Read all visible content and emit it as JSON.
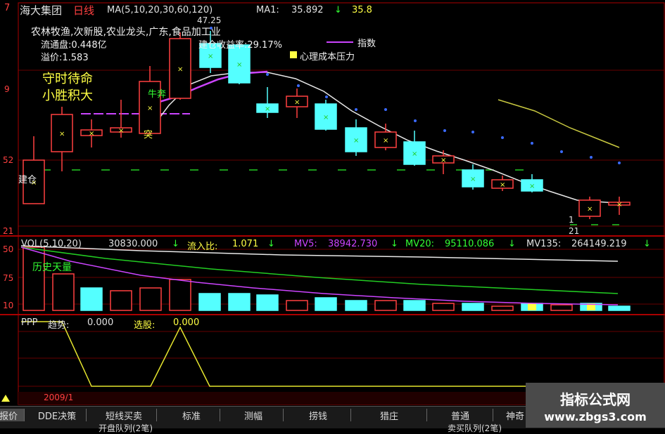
{
  "header": {
    "stock_name": "海大集团",
    "period": "日线",
    "ma_label": "MA(5,10,20,30,60,120)",
    "ma1_label": "MA1:",
    "ma1_value": "35.892",
    "ma1_arrow": "↓",
    "ma_extra": "35.8",
    "left_price_top": "7"
  },
  "info": {
    "industry": "农林牧渔,次新股,农业龙头,广东,食品加工业",
    "float_label": "流通盘:0.448亿",
    "return_label": "建仓收益率:29.17%",
    "premium_label": "溢价:1.583",
    "index_label": "指数",
    "pressure_label": "心理成本压力",
    "slogan_line1": "守时待命",
    "slogan_line2": "小胜积大",
    "high_price": "47.25",
    "annot_bull": "牛奔",
    "annot_tu": "突",
    "annot_build": "建仓",
    "annot_low": "21",
    "annot_one": "1"
  },
  "left_axis": {
    "p1": "9",
    "p2": "52",
    "p3": "21",
    "v1": "50",
    "v2": "75",
    "v3": "10"
  },
  "volume": {
    "label": "VOL(5,10,20)",
    "value": "30830.000",
    "arrow": "↓",
    "inflow_label": "流入比:",
    "inflow_value": "1.071",
    "inflow_arrow": "↓",
    "mv5_label": "MV5:",
    "mv5_value": "38942.730",
    "mv5_arrow": "↓",
    "mv20_label": "MV20:",
    "mv20_value": "95110.086",
    "mv20_arrow": "↓",
    "mv135_label": "MV135:",
    "mv135_value": "264149.219",
    "mv135_arrow": "↓",
    "history_label": "历史天量"
  },
  "indicator": {
    "label": "PPP",
    "trend_label": "趋势:",
    "trend_value": "0.000",
    "select_label": "选股:",
    "select_value": "0.000"
  },
  "date_label": "2009/1",
  "tabs": [
    "报价",
    "DDE决策",
    "短线买卖",
    "标准",
    "测幅",
    "捞钱",
    "猎庄",
    "普通",
    "神奇"
  ],
  "bottom_partial_left": "开盘队列(2笔)",
  "bottom_partial_right": "卖买队列(2笔)",
  "watermark": {
    "line1": "指标公式网",
    "line2": "www.zbgs3.com"
  },
  "colors": {
    "background": "#000000",
    "up_candle": "#ff4040",
    "down_candle": "#54ffff",
    "ma_white": "#ffffff",
    "ma_purple": "#cc44ff",
    "ma_green": "#22cc22",
    "ma_yellow": "#e6e62e",
    "grid_red": "#aa0000",
    "text_yellow": "#ffff44",
    "text_green": "#33ff33"
  }
}
